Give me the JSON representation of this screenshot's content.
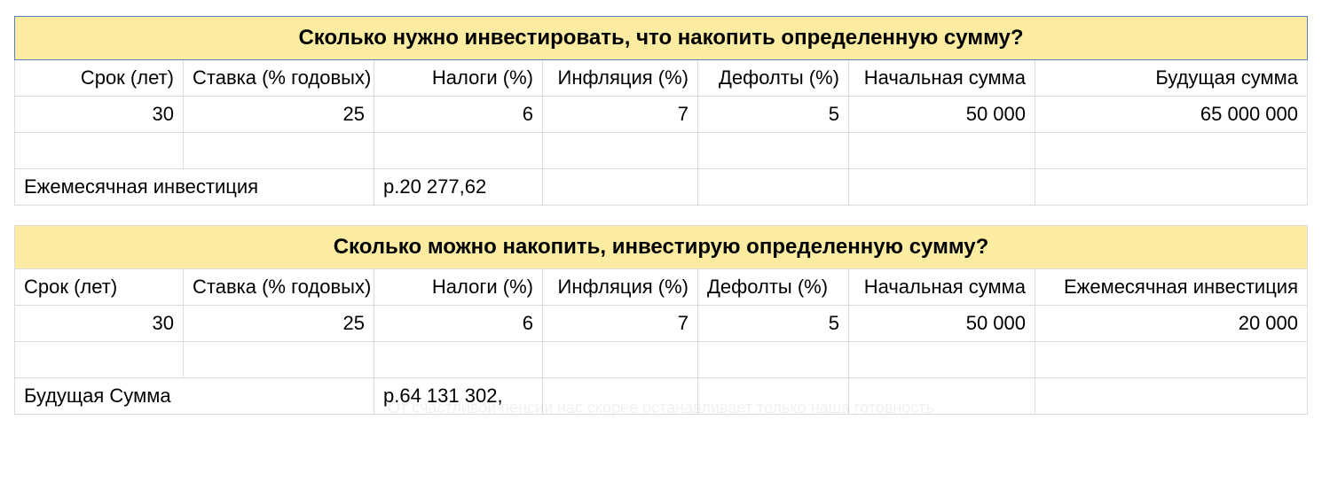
{
  "table1": {
    "title": "Сколько нужно инвестировать, что накопить определенную сумму?",
    "headers": {
      "term": "Срок (лет)",
      "rate": "Ставка (% годовых)",
      "tax": "Налоги (%)",
      "inflation": "Инфляция (%)",
      "defaults": "Дефолты (%)",
      "initial": "Начальная сумма",
      "future": "Будущая сумма"
    },
    "values": {
      "term": "30",
      "rate": "25",
      "tax": "6",
      "inflation": "7",
      "defaults": "5",
      "initial": "50 000",
      "future": "65 000 000"
    },
    "result": {
      "label": "Ежемесячная инвестиция",
      "value": "р.20 277,62"
    }
  },
  "table2": {
    "title": "Сколько можно накопить, инвестирую определенную сумму?",
    "headers": {
      "term": "Срок (лет)",
      "rate": "Ставка (% годовых)",
      "tax": "Налоги (%)",
      "inflation": "Инфляция (%)",
      "defaults": "Дефолты (%)",
      "initial": "Начальная сумма",
      "monthly": "Ежемесячная инвестиция"
    },
    "values": {
      "term": "30",
      "rate": "25",
      "tax": "6",
      "inflation": "7",
      "defaults": "5",
      "initial": "50 000",
      "monthly": "20 000"
    },
    "result": {
      "label": "Будущая Сумма",
      "value": "р.64 131 302,"
    }
  },
  "watermark": "От счастливой пенсии нас скорее останавливает только наша готовность"
}
